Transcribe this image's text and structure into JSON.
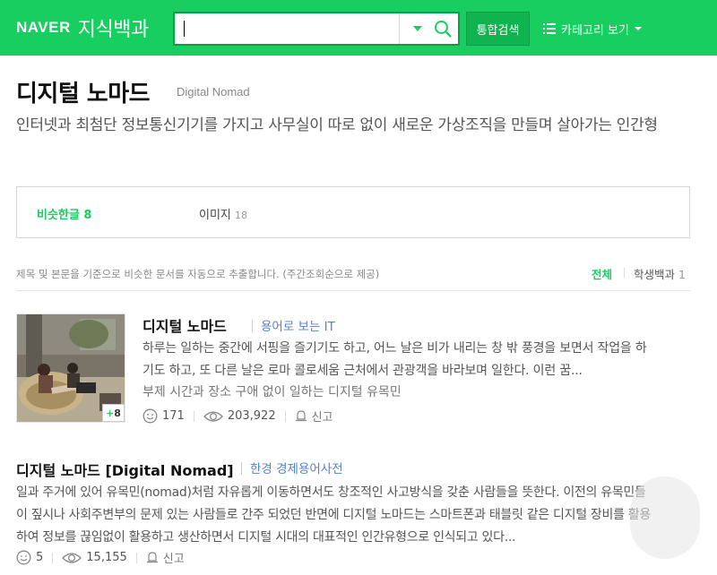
{
  "header": {
    "logo_naver": "NAVER",
    "logo_service": "지식백과",
    "search": {
      "value": "",
      "placeholder": ""
    },
    "total_search_label": "통합검색",
    "category_label": "카테고리 보기"
  },
  "entry": {
    "title": "디지털 노마드",
    "subtitle": "Digital Nomad",
    "description": "인터넷과 최첨단 정보통신기기를 가지고 사무실이 따로 없이 새로운 가상조직을 만들며 살아가는 인간형"
  },
  "tabs": [
    {
      "label": "비슷한글",
      "count": "8",
      "active": true
    },
    {
      "label": "이미지",
      "count": "18",
      "active": false
    }
  ],
  "filter": {
    "info": "제목 및 본문을 기준으로 비슷한 문서를 자동으로 추출합니다. (주간조회순으로 제공)",
    "all_label": "전체",
    "student_label": "학생백과",
    "student_count": "1"
  },
  "results": [
    {
      "title": "디지털 노마드",
      "source": "용어로 보는 IT",
      "body": "하루는 일하는 중간에 서핑을 즐기기도 하고, 어느 날은 비가 내리는 창 밖 풍경을 보면서 작업을 하기도 하고, 또 다른 날은 로마 콜로세움 근처에서 관광객을 바라보며 일한다. 이런 꿈...",
      "extra": "부제 시간과 장소 구애 없이 일하는 디지털 유목민",
      "thumb_badge": "8",
      "likes": "171",
      "views": "203,922",
      "report_label": "신고"
    },
    {
      "title": "디지털 노마드 [Digital Nomad]",
      "source": "한경 경제용어사전",
      "body": "일과 주거에 있어 유목민(nomad)처럼 자유롭게 이동하면서도 창조적인 사고방식을 갖춘 사람들을 뜻한다. 이전의 유목민들이 짚시나 사회주변부의 문제 있는 사람들로 간주 되었던 반면에 디지털 노마드는 스마트폰과 태블릿 같은 디지털 장비를 활용하여 정보를 끊임없이 활용하고 생산하면서 디지털 시대의 대표적인 인간유형으로 인식되고 있다...",
      "likes": "5",
      "views": "15,155",
      "report_label": "신고"
    }
  ],
  "colors": {
    "brand": "#19ce60",
    "source_link": "#5582c8"
  },
  "icons": [
    "search-icon",
    "dropdown-arrow-icon",
    "list-icon",
    "caret-down-icon",
    "smile-icon",
    "eye-icon",
    "report-bell-icon"
  ]
}
